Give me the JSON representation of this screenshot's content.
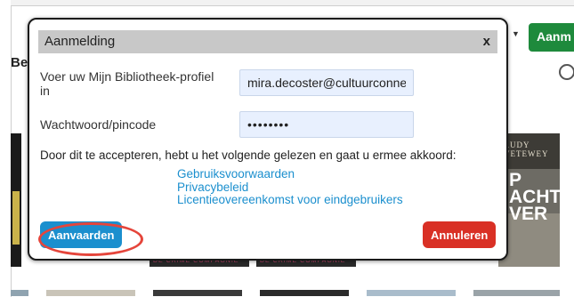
{
  "background": {
    "partial_heading": "Be",
    "login_button_partial": "Aanm",
    "cover_right_author": "RUDY\nVETEWEY",
    "cover_right_title": "P\nACHT\nVER",
    "cover_series_left": "DE CRIME COMPAGNIE",
    "cover_series_right": "DE CRIME COMPAGNIE"
  },
  "modal": {
    "title": "Aanmelding",
    "close_label": "x",
    "username": {
      "label": "Voer uw Mijn Bibliotheek-profiel in",
      "value": "mira.decoster@cultuurconnect.be"
    },
    "password": {
      "label": "Wachtwoord/pincode",
      "value": "secret12"
    },
    "consent_text": "Door dit te accepteren, hebt u het volgende gelezen en gaat u ermee akkoord:",
    "links": [
      "Gebruiksvoorwaarden",
      "Privacybeleid",
      "Licentieovereenkomst voor eindgebruikers"
    ],
    "accept_label": "Aanvaarden",
    "cancel_label": "Annuleren"
  },
  "colors": {
    "accent": "#1b8fce",
    "danger": "#d93025",
    "login_green": "#1e8a3c",
    "annotation": "#e5453b"
  }
}
